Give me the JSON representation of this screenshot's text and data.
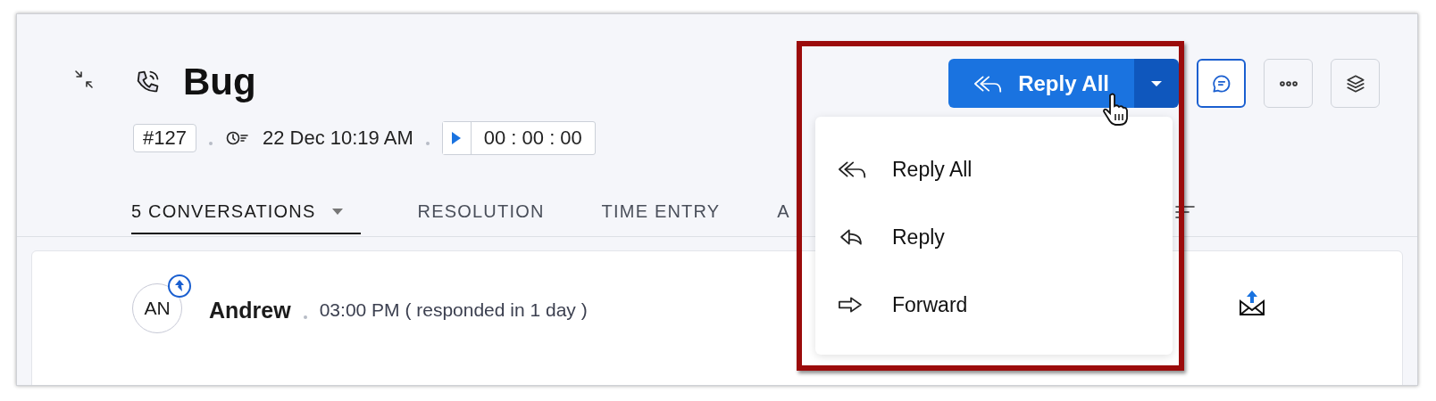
{
  "title": "Bug",
  "ticket_id": "#127",
  "created": "22 Dec 10:19 AM",
  "timer": "00 : 00 : 00",
  "tabs": [
    {
      "label": "5 CONVERSATIONS",
      "selected": true,
      "dropdown": true
    },
    {
      "label": "RESOLUTION",
      "selected": false,
      "dropdown": false
    },
    {
      "label": "TIME ENTRY",
      "selected": false,
      "dropdown": false
    },
    {
      "label": "A",
      "selected": false,
      "dropdown": false
    }
  ],
  "reply_button": {
    "label": "Reply All"
  },
  "toolbar": [
    {
      "kind": "chat",
      "selected": true
    },
    {
      "kind": "more",
      "selected": false
    },
    {
      "kind": "layers",
      "selected": false
    }
  ],
  "reply_menu": [
    {
      "kind": "reply_all",
      "label": "Reply All"
    },
    {
      "kind": "reply",
      "label": "Reply"
    },
    {
      "kind": "forward",
      "label": "Forward"
    }
  ],
  "conversation": {
    "initials": "AN",
    "name": "Andrew",
    "time": "03:00 PM ( responded in 1 day )"
  }
}
